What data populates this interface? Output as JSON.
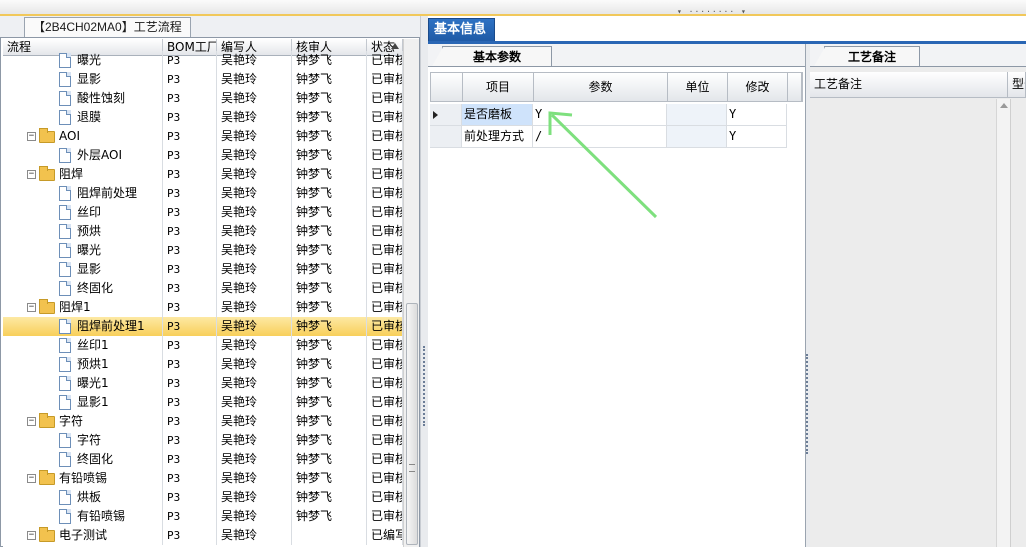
{
  "left_tab": {
    "label": "【2B4CH02MA0】工艺流程"
  },
  "tree": {
    "columns": [
      "流程",
      "BOM工厂",
      "编写人",
      "核审人",
      "状态"
    ],
    "rows": [
      {
        "depth": 2,
        "type": "doc",
        "label": "曝光",
        "bom": "P3",
        "writer": "吴艳玲",
        "reviewer": "钟梦飞",
        "status": "已审核"
      },
      {
        "depth": 2,
        "type": "doc",
        "label": "显影",
        "bom": "P3",
        "writer": "吴艳玲",
        "reviewer": "钟梦飞",
        "status": "已审核"
      },
      {
        "depth": 2,
        "type": "doc",
        "label": "酸性蚀刻",
        "bom": "P3",
        "writer": "吴艳玲",
        "reviewer": "钟梦飞",
        "status": "已审核"
      },
      {
        "depth": 2,
        "type": "doc",
        "label": "退膜",
        "bom": "P3",
        "writer": "吴艳玲",
        "reviewer": "钟梦飞",
        "status": "已审核"
      },
      {
        "depth": 1,
        "type": "folder",
        "label": "AOI",
        "bom": "P3",
        "writer": "吴艳玲",
        "reviewer": "钟梦飞",
        "status": "已审核"
      },
      {
        "depth": 2,
        "type": "doc",
        "label": "外层AOI",
        "bom": "P3",
        "writer": "吴艳玲",
        "reviewer": "钟梦飞",
        "status": "已审核"
      },
      {
        "depth": 1,
        "type": "folder",
        "label": "阻焊",
        "bom": "P3",
        "writer": "吴艳玲",
        "reviewer": "钟梦飞",
        "status": "已审核"
      },
      {
        "depth": 2,
        "type": "doc",
        "label": "阻焊前处理",
        "bom": "P3",
        "writer": "吴艳玲",
        "reviewer": "钟梦飞",
        "status": "已审核"
      },
      {
        "depth": 2,
        "type": "doc",
        "label": "丝印",
        "bom": "P3",
        "writer": "吴艳玲",
        "reviewer": "钟梦飞",
        "status": "已审核"
      },
      {
        "depth": 2,
        "type": "doc",
        "label": "预烘",
        "bom": "P3",
        "writer": "吴艳玲",
        "reviewer": "钟梦飞",
        "status": "已审核"
      },
      {
        "depth": 2,
        "type": "doc",
        "label": "曝光",
        "bom": "P3",
        "writer": "吴艳玲",
        "reviewer": "钟梦飞",
        "status": "已审核"
      },
      {
        "depth": 2,
        "type": "doc",
        "label": "显影",
        "bom": "P3",
        "writer": "吴艳玲",
        "reviewer": "钟梦飞",
        "status": "已审核"
      },
      {
        "depth": 2,
        "type": "doc",
        "label": "终固化",
        "bom": "P3",
        "writer": "吴艳玲",
        "reviewer": "钟梦飞",
        "status": "已审核"
      },
      {
        "depth": 1,
        "type": "folder",
        "label": "阻焊1",
        "bom": "P3",
        "writer": "吴艳玲",
        "reviewer": "钟梦飞",
        "status": "已审核"
      },
      {
        "depth": 2,
        "type": "doc",
        "label": "阻焊前处理1",
        "bom": "P3",
        "writer": "吴艳玲",
        "reviewer": "钟梦飞",
        "status": "已审核",
        "selected": true
      },
      {
        "depth": 2,
        "type": "doc",
        "label": "丝印1",
        "bom": "P3",
        "writer": "吴艳玲",
        "reviewer": "钟梦飞",
        "status": "已审核"
      },
      {
        "depth": 2,
        "type": "doc",
        "label": "预烘1",
        "bom": "P3",
        "writer": "吴艳玲",
        "reviewer": "钟梦飞",
        "status": "已审核"
      },
      {
        "depth": 2,
        "type": "doc",
        "label": "曝光1",
        "bom": "P3",
        "writer": "吴艳玲",
        "reviewer": "钟梦飞",
        "status": "已审核"
      },
      {
        "depth": 2,
        "type": "doc",
        "label": "显影1",
        "bom": "P3",
        "writer": "吴艳玲",
        "reviewer": "钟梦飞",
        "status": "已审核"
      },
      {
        "depth": 1,
        "type": "folder",
        "label": "字符",
        "bom": "P3",
        "writer": "吴艳玲",
        "reviewer": "钟梦飞",
        "status": "已审核"
      },
      {
        "depth": 2,
        "type": "doc",
        "label": "字符",
        "bom": "P3",
        "writer": "吴艳玲",
        "reviewer": "钟梦飞",
        "status": "已审核"
      },
      {
        "depth": 2,
        "type": "doc",
        "label": "终固化",
        "bom": "P3",
        "writer": "吴艳玲",
        "reviewer": "钟梦飞",
        "status": "已审核"
      },
      {
        "depth": 1,
        "type": "folder",
        "label": "有铅喷锡",
        "bom": "P3",
        "writer": "吴艳玲",
        "reviewer": "钟梦飞",
        "status": "已审核"
      },
      {
        "depth": 2,
        "type": "doc",
        "label": "烘板",
        "bom": "P3",
        "writer": "吴艳玲",
        "reviewer": "钟梦飞",
        "status": "已审核"
      },
      {
        "depth": 2,
        "type": "doc",
        "label": "有铅喷锡",
        "bom": "P3",
        "writer": "吴艳玲",
        "reviewer": "钟梦飞",
        "status": "已审核"
      },
      {
        "depth": 1,
        "type": "folder",
        "label": "电子测试",
        "bom": "P3",
        "writer": "吴艳玲",
        "reviewer": "",
        "status": "已编写"
      }
    ]
  },
  "info_tab": {
    "label": "基本信息"
  },
  "params": {
    "tab_label": "基本参数",
    "columns": [
      "项目",
      "参数",
      "单位",
      "修改"
    ],
    "rows": [
      {
        "item": "是否磨板",
        "param": "Y",
        "unit": "",
        "modify": "Y",
        "current": true
      },
      {
        "item": "前处理方式",
        "param": "/",
        "unit": "",
        "modify": "Y",
        "current": false
      }
    ]
  },
  "notes": {
    "tab_label": "工艺备注",
    "columns": [
      "工艺备注",
      "型号"
    ]
  },
  "colors": {
    "accent_blue": "#2a66b4",
    "selection": "#f8cf5a",
    "annotation_arrow": "#7ee07e"
  }
}
